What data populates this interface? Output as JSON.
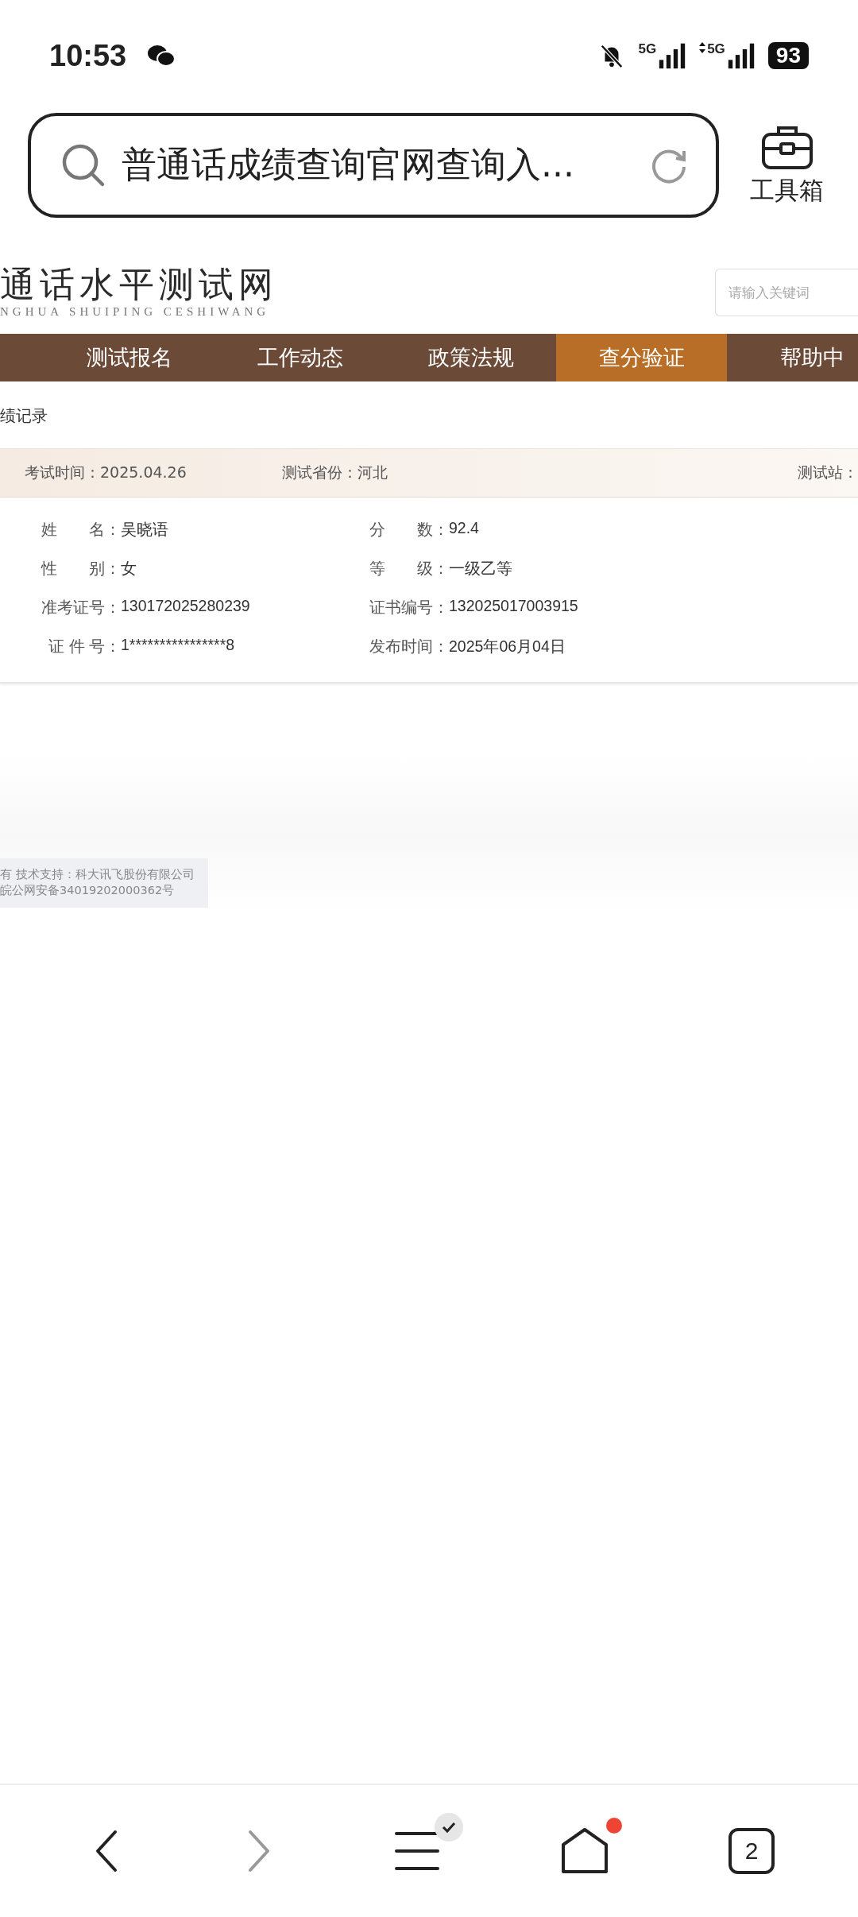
{
  "status_bar": {
    "time": "10:53",
    "network_1": "5G",
    "network_2": "5G",
    "battery": "93"
  },
  "search_bar": {
    "query": "普通话成绩查询官网查询入...",
    "toolbox_label": "工具箱"
  },
  "site_header": {
    "logo_title": "通话水平测试网",
    "logo_subtitle": "NGHUA SHUIPING CESHIWANG",
    "search": {
      "placeholder": "请输入关键词"
    }
  },
  "nav": [
    {
      "label": "测试报名",
      "selected": false
    },
    {
      "label": "工作动态",
      "selected": false
    },
    {
      "label": "政策法规",
      "selected": false
    },
    {
      "label": "查分验证",
      "selected": true
    },
    {
      "label": "帮助中",
      "selected": false
    }
  ],
  "breadcrumb": "绩记录",
  "exam_info": [
    {
      "label": "考试时间：",
      "value": "2025.04.26"
    },
    {
      "label": "测试省份：",
      "value": "河北"
    },
    {
      "label": "测试站："
    }
  ],
  "record_rows": [
    [
      {
        "label": "姓　　名：",
        "value": "吴晓语"
      },
      {
        "label": "分　　数：",
        "value": "92.4"
      }
    ],
    [
      {
        "label": "性　　别：",
        "value": "女"
      },
      {
        "label": "等　　级：",
        "value": "一级乙等"
      }
    ],
    [
      {
        "label": "准考证号：",
        "value": "130172025280239"
      },
      {
        "label": "证书编号：",
        "value": "132025017003915"
      }
    ],
    [
      {
        "label": "证 件 号：",
        "value": "1****************8"
      },
      {
        "label": "发布时间：",
        "value": "2025年06月04日"
      }
    ]
  ],
  "footer": [
    "有 技术支持：科大讯飞股份有限公司",
    "皖公网安备34019202000362号"
  ],
  "bottom_nav": {
    "back_disabled": false,
    "forward_disabled": true,
    "menu_badge": true,
    "home_dot": true,
    "tab_count": "2"
  }
}
